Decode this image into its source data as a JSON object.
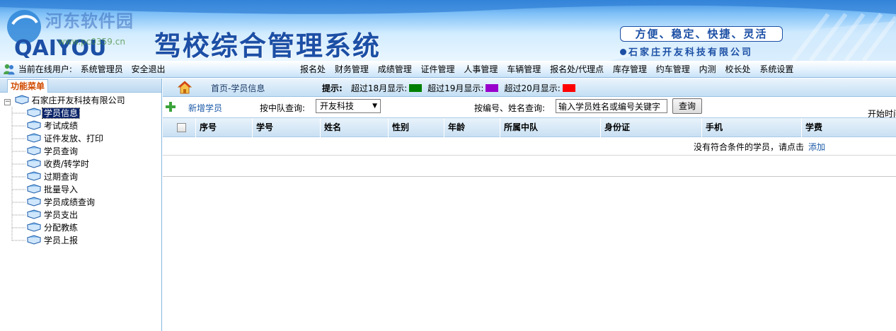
{
  "banner": {
    "watermark": "河东软件园",
    "watermark_url": "www.pc0359.cn",
    "logo_text": "QAIYOU",
    "title": "驾校综合管理系统",
    "slogan": "方便、稳定、快捷、灵活",
    "company": "石家庄开友科技有限公司"
  },
  "topbar": {
    "online_label": "当前在线用户:",
    "user": "系统管理员",
    "logout": "安全退出",
    "menu": [
      "报名处",
      "财务管理",
      "成绩管理",
      "证件管理",
      "人事管理",
      "车辆管理",
      "报名处/代理点",
      "库存管理",
      "约车管理",
      "内测",
      "校长处",
      "系统设置"
    ]
  },
  "sidebar": {
    "title": "功能菜单",
    "root": "石家庄开友科技有限公司",
    "items": [
      "学员信息",
      "考试成绩",
      "证件发放、打印",
      "学员查询",
      "收费/转学时",
      "过期查询",
      "批量导入",
      "学员成绩查询",
      "学员支出",
      "分配教练",
      "学员上报"
    ],
    "active_index": 0
  },
  "main": {
    "breadcrumb": "首页-学员信息",
    "hint": {
      "label": "提示:",
      "items": [
        {
          "text": "超过18月显示:",
          "color": "#008000"
        },
        {
          "text": "超过19月显示:",
          "color": "#9900cc"
        },
        {
          "text": "超过20月显示:",
          "color": "#ff0000"
        }
      ]
    },
    "toolbar": {
      "add": "新增学员",
      "team_label": "按中队查询:",
      "team_value": "开友科技",
      "keyword_label": "按编号、姓名查询:",
      "keyword_placeholder": "输入学员姓名或编号关键字",
      "query": "查询",
      "start_time": "开始时间"
    },
    "table": {
      "columns": [
        "序号",
        "学号",
        "姓名",
        "性别",
        "年龄",
        "所属中队",
        "身份证",
        "手机",
        "学费"
      ],
      "empty_text": "没有符合条件的学员，请点击",
      "empty_link": "添加"
    }
  }
}
